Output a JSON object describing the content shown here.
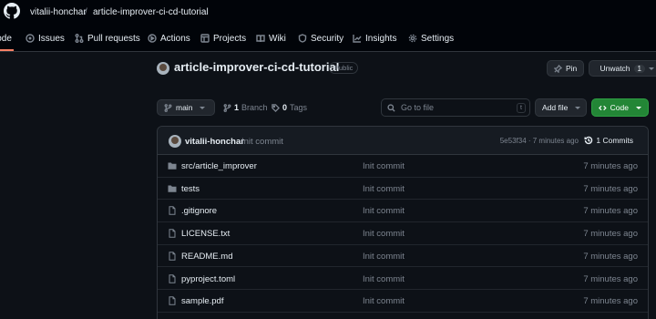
{
  "header": {
    "owner": "vitalii-honchar",
    "separator": "/",
    "repo": "article-improver-ci-cd-tutorial"
  },
  "nav_tabs": [
    {
      "label": "Code",
      "icon": "code-icon"
    },
    {
      "label": "Issues",
      "icon": "issue-icon"
    },
    {
      "label": "Pull requests",
      "icon": "pull-request-icon"
    },
    {
      "label": "Actions",
      "icon": "play-icon"
    },
    {
      "label": "Projects",
      "icon": "table-icon"
    },
    {
      "label": "Wiki",
      "icon": "book-icon"
    },
    {
      "label": "Security",
      "icon": "shield-icon"
    },
    {
      "label": "Insights",
      "icon": "graph-icon"
    },
    {
      "label": "Settings",
      "icon": "gear-icon"
    }
  ],
  "repo": {
    "name": "article-improver-ci-cd-tutorial",
    "visibility": "Public",
    "pin_label": "Pin",
    "unwatch_label": "Unwatch",
    "watch_count": "1"
  },
  "toolbar": {
    "branch": "main",
    "branch_count": "1",
    "branch_label": "Branch",
    "tag_count": "0",
    "tag_label": "Tags",
    "search_placeholder": "Go to file",
    "search_shortcut": "t",
    "add_file_label": "Add file",
    "code_label": "Code"
  },
  "latest_commit": {
    "author": "vitalii-honchar",
    "message": "Init commit",
    "hash_and_time": "5e53f34 · 7 minutes ago",
    "commit_count": "1 Commits"
  },
  "files": [
    {
      "name": "src/article_improver",
      "type": "folder",
      "message": "Init commit",
      "age": "7 minutes ago"
    },
    {
      "name": "tests",
      "type": "folder",
      "message": "Init commit",
      "age": "7 minutes ago"
    },
    {
      "name": ".gitignore",
      "type": "file",
      "message": "Init commit",
      "age": "7 minutes ago"
    },
    {
      "name": "LICENSE.txt",
      "type": "file",
      "message": "Init commit",
      "age": "7 minutes ago"
    },
    {
      "name": "README.md",
      "type": "file",
      "message": "Init commit",
      "age": "7 minutes ago"
    },
    {
      "name": "pyproject.toml",
      "type": "file",
      "message": "Init commit",
      "age": "7 minutes ago"
    },
    {
      "name": "sample.pdf",
      "type": "file",
      "message": "Init commit",
      "age": "7 minutes ago"
    }
  ],
  "colors": {
    "background": "#0d1117",
    "header_bg": "#010409",
    "border": "#30363d",
    "accent_green": "#238636",
    "active_tab_underline": "#f78166",
    "muted_text": "#7d8590"
  }
}
